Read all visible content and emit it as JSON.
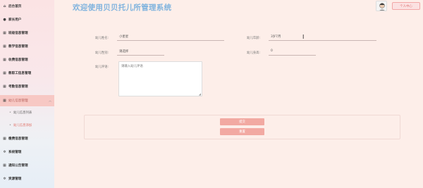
{
  "header": {
    "title": "欢迎使用贝贝托儿所管理系统",
    "profile_label": "个人中心"
  },
  "sidebar": {
    "items": [
      {
        "label": "后台首页",
        "icon": "home-icon"
      },
      {
        "label": "家长用户",
        "icon": "user-icon"
      },
      {
        "label": "班级信息管理",
        "icon": "grid-icon"
      },
      {
        "label": "教学信息管理",
        "icon": "grid-icon"
      },
      {
        "label": "收费信息管理",
        "icon": "grid-icon"
      },
      {
        "label": "教职工信息管理",
        "icon": "grid-icon"
      },
      {
        "label": "考勤信息管理",
        "icon": "grid-icon"
      },
      {
        "label": "幼儿信息管理",
        "icon": "grid-icon"
      },
      {
        "label": "缴费信息管理",
        "icon": "grid-icon"
      },
      {
        "label": "系统管理",
        "icon": "gear-icon"
      },
      {
        "label": "通知公告管理",
        "icon": "grid-icon"
      },
      {
        "label": "资源管理",
        "icon": "gear-icon"
      }
    ],
    "sub_items": [
      {
        "label": "幼儿信息列表"
      },
      {
        "label": "幼儿信息添加"
      }
    ]
  },
  "form": {
    "name_label": "幼儿姓名:",
    "name_value": "小星星",
    "age_label": "幼儿年龄:",
    "age_value": "3岁7月",
    "gender_label": "幼儿性别:",
    "gender_value": "请选择",
    "height_label": "幼儿身高:",
    "height_value": "0",
    "comment_label": "幼儿评语:",
    "comment_placeholder": "请输入幼儿评语"
  },
  "actions": {
    "submit_label": "提交",
    "reset_label": "重置"
  }
}
